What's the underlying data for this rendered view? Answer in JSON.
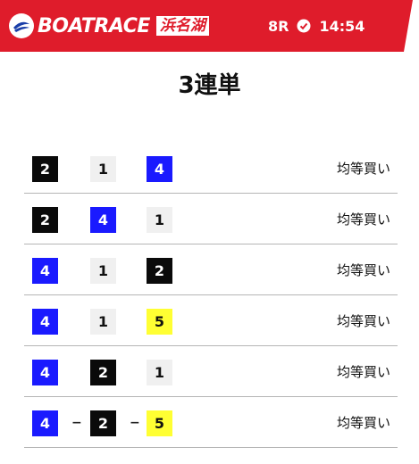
{
  "header": {
    "logo_text": "BOATRACE",
    "venue": "浜名湖",
    "race_no": "8R",
    "time": "14:54",
    "icon": "clock-icon",
    "color_red": "#df1c2b"
  },
  "title": "3連単",
  "colors": {
    "1": "#f0f0f0",
    "2": "#0a0a0a",
    "4": "#1a1aff",
    "5": "#ffff33"
  },
  "bets": [
    {
      "boats": [
        "2",
        "1",
        "4"
      ],
      "separators": [
        "",
        ""
      ],
      "label": "均等買い"
    },
    {
      "boats": [
        "2",
        "4",
        "1"
      ],
      "separators": [
        "",
        ""
      ],
      "label": "均等買い"
    },
    {
      "boats": [
        "4",
        "1",
        "2"
      ],
      "separators": [
        "",
        ""
      ],
      "label": "均等買い"
    },
    {
      "boats": [
        "4",
        "1",
        "5"
      ],
      "separators": [
        "",
        ""
      ],
      "label": "均等買い"
    },
    {
      "boats": [
        "4",
        "2",
        "1"
      ],
      "separators": [
        "",
        ""
      ],
      "label": "均等買い"
    },
    {
      "boats": [
        "4",
        "2",
        "5"
      ],
      "separators": [
        "−",
        "−"
      ],
      "label": "均等買い"
    }
  ]
}
